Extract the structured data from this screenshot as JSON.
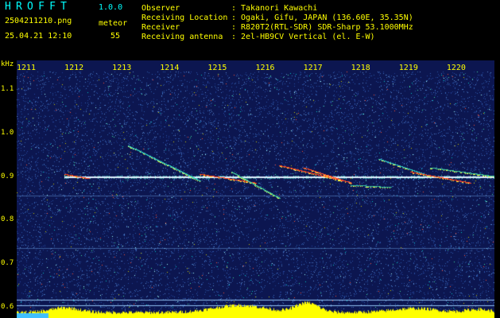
{
  "header": {
    "app_title": "HROFFT",
    "app_version": "1.0.0",
    "file_name": "2504211210.png",
    "timestamp": "25.04.21 12:10",
    "detect_label": "meteor",
    "detect_count": "55",
    "info": [
      {
        "label": "Observer",
        "value": "Takanori Kawachi"
      },
      {
        "label": "Receiving Location",
        "value": "Ogaki, Gifu, JAPAN (136.60E, 35.35N)"
      },
      {
        "label": "Receiver",
        "value": "R820T2(RTL-SDR) SDR-Sharp 53.1000MHz"
      },
      {
        "label": "Receiving antenna",
        "value": "2el-HB9CV Vertical (el. E-W)"
      }
    ]
  },
  "axes": {
    "freq_unit": "kHz",
    "freq_ticks": [
      {
        "label": "1.1",
        "value": 1.1
      },
      {
        "label": "1.0",
        "value": 1.0
      },
      {
        "label": "0.9",
        "value": 0.9
      },
      {
        "label": "0.8",
        "value": 0.8
      },
      {
        "label": "0.7",
        "value": 0.7
      },
      {
        "label": "0.6",
        "value": 0.6
      }
    ],
    "freq_range": [
      0.575,
      1.165
    ],
    "time_ticks": [
      "1211",
      "1212",
      "1213",
      "1214",
      "1215",
      "1216",
      "1217",
      "1218",
      "1219",
      "1220"
    ],
    "time_range_minutes": [
      1210.8,
      1220.8
    ]
  },
  "colors": {
    "background": "#0c1650",
    "noise": "#2f5aa8",
    "carrier": "#e0f0ff",
    "meteor": "#ff3a20",
    "spectrum": "#ffff00",
    "label": "#ffff00",
    "title": "#00ffff"
  }
}
